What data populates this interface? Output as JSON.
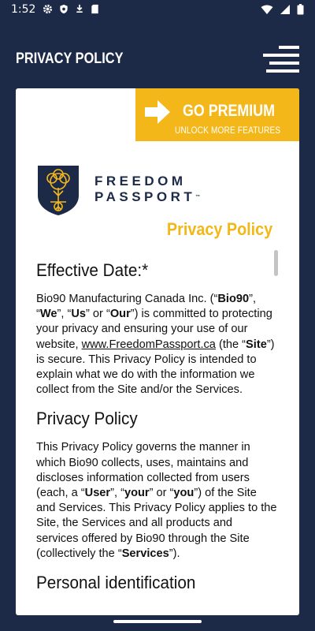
{
  "status_bar": {
    "time": "1:52"
  },
  "app_bar": {
    "title": "PRIVACY POLICY"
  },
  "premium_banner": {
    "title": "GO PREMIUM",
    "subtitle": "UNLOCK MORE FEATURES",
    "color": "#f3b71a"
  },
  "brand": {
    "line1": "FREEDOM",
    "line2": "PASSPORT",
    "tm": "™"
  },
  "page_heading": "Privacy Policy",
  "sections": {
    "effective_heading": "Effective Date:*",
    "intro": {
      "t1": "Bio90 Manufacturing Canada Inc. (“",
      "b1": "Bio90",
      "t2": "”, “",
      "b2": "We",
      "t3": "”, “",
      "b3": "Us",
      "t4": "” or “",
      "b4": "Our",
      "t5": "”) is committed to protecting your privacy and ensuring your use of our website, ",
      "link": "www.FreedomPassport.ca",
      "t6": " (the “",
      "b5": "Site",
      "t7": "”) is secure. This Privacy Policy is intended to explain what we do with the information we collect from the Site and/or the Services."
    },
    "policy_heading": "Privacy Policy",
    "policy": {
      "t1": "This Privacy Policy governs the manner in which Bio90 collects, uses, maintains and discloses information collected from users (each, a “",
      "b1": "User",
      "t2": "”, “",
      "b2": "your",
      "t3": "” or “",
      "b3": "you",
      "t4": "”) of the Site and Services. This Privacy Policy applies to the Site, the Services and all products and services offered by Bio90 through the Site (collectively the “",
      "b4": "Services",
      "t5": "”)."
    },
    "next_heading": "Personal identification"
  },
  "colors": {
    "navy": "#1c2a48",
    "gold": "#f3b71a"
  }
}
